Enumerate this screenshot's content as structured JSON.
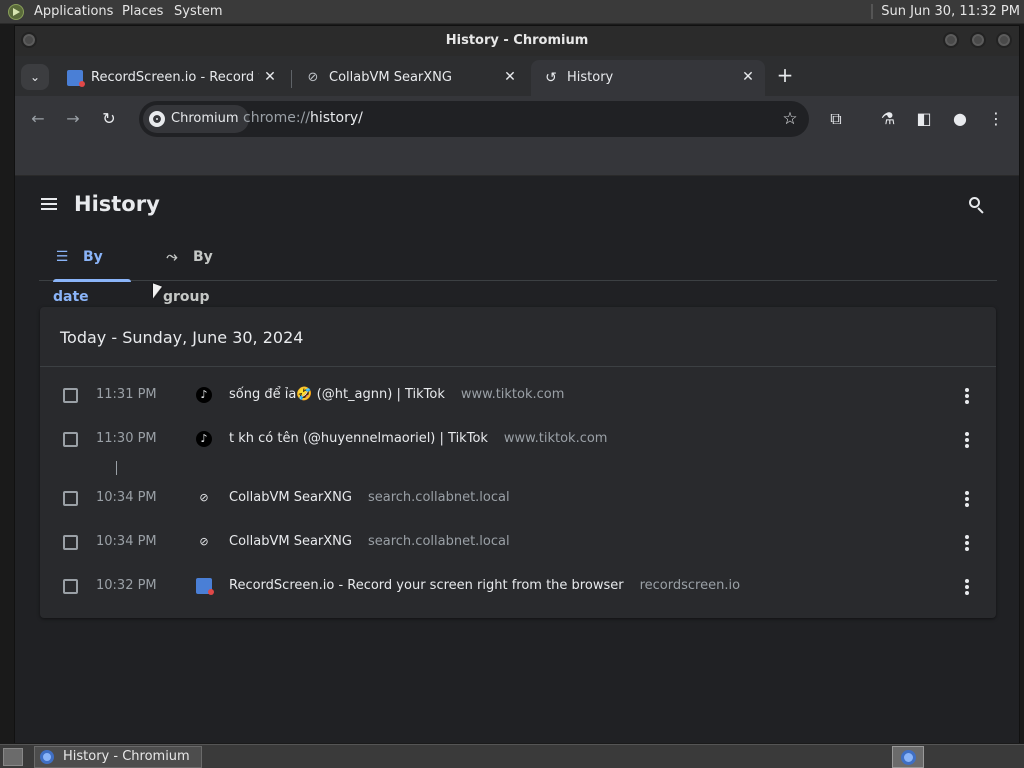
{
  "top_panel": {
    "menus": [
      "Applications",
      "Places",
      "System"
    ],
    "clock": "Sun Jun 30, 11:32 PM"
  },
  "window": {
    "title": "History - Chromium"
  },
  "tabs": [
    {
      "title": "RecordScreen.io - Record you",
      "icon": "recordscreen-favicon",
      "active": false
    },
    {
      "title": "CollabVM SearXNG",
      "icon": "searxng-favicon",
      "active": false
    },
    {
      "title": "History",
      "icon": "history-icon",
      "active": true
    }
  ],
  "toolbar": {
    "chip_label": "Chromium",
    "url_prefix": "chrome://",
    "url_host": "history",
    "url_suffix": "/"
  },
  "history_page": {
    "title": "History",
    "view_tabs": [
      {
        "label": "By date",
        "icon": "list-icon",
        "selected": true
      },
      {
        "label": "By group",
        "icon": "group-icon",
        "selected": false
      }
    ],
    "day_header": "Today - Sunday, June 30, 2024",
    "entries": [
      {
        "time": "11:31 PM",
        "favicon": "tiktok",
        "title": "sống để ỉa🤣 (@ht_agnn) | TikTok",
        "domain": "www.tiktok.com"
      },
      {
        "time": "11:30 PM",
        "favicon": "tiktok",
        "title": "t kh có tên (@huyennelmaoriel) | TikTok",
        "domain": "www.tiktok.com"
      },
      {
        "time": "10:34 PM",
        "favicon": "searxng",
        "title": "CollabVM SearXNG",
        "domain": "search.collabnet.local"
      },
      {
        "time": "10:34 PM",
        "favicon": "searxng",
        "title": "CollabVM SearXNG",
        "domain": "search.collabnet.local"
      },
      {
        "time": "10:32 PM",
        "favicon": "recordscreen",
        "title": "RecordScreen.io - Record your screen right from the browser",
        "domain": "recordscreen.io"
      }
    ]
  },
  "taskbar": {
    "task_label": "History - Chromium"
  },
  "colors": {
    "accent": "#8ab4f8",
    "page_bg": "#202124",
    "card_bg": "#292a2d"
  }
}
